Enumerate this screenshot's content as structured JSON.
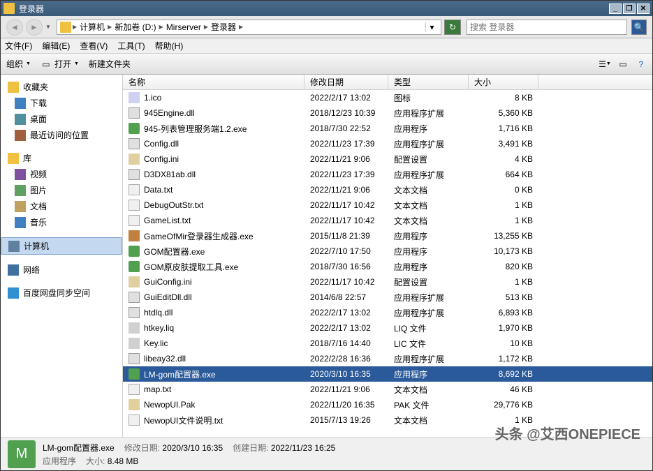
{
  "window": {
    "title": "登录器"
  },
  "address": {
    "segments": [
      "计算机",
      "新加卷 (D:)",
      "Mirserver",
      "登录器"
    ]
  },
  "search": {
    "placeholder": "搜索 登录器"
  },
  "menu": {
    "file": "文件(F)",
    "edit": "编辑(E)",
    "view": "查看(V)",
    "tools": "工具(T)",
    "help": "帮助(H)"
  },
  "toolbar": {
    "org": "组织",
    "open": "打开",
    "newfolder": "新建文件夹"
  },
  "sidebar": {
    "fav": "收藏夹",
    "dl": "下载",
    "desk": "桌面",
    "recent": "最近访问的位置",
    "lib": "库",
    "vid": "视频",
    "pic": "图片",
    "doc": "文档",
    "music": "音乐",
    "pc": "计算机",
    "net": "网络",
    "baidu": "百度网盘同步空间"
  },
  "columns": {
    "name": "名称",
    "modified": "修改日期",
    "type": "类型",
    "size": "大小"
  },
  "files": [
    {
      "name": "1.ico",
      "date": "2022/2/17 13:02",
      "type": "图标",
      "size": "8 KB",
      "ico": "fi-ico"
    },
    {
      "name": "945Engine.dll",
      "date": "2018/12/23 10:39",
      "type": "应用程序扩展",
      "size": "5,360 KB",
      "ico": "fi-dll"
    },
    {
      "name": "945-列表管理服务端1.2.exe",
      "date": "2018/7/30 22:52",
      "type": "应用程序",
      "size": "1,716 KB",
      "ico": "fi-exe"
    },
    {
      "name": "Config.dll",
      "date": "2022/11/23 17:39",
      "type": "应用程序扩展",
      "size": "3,491 KB",
      "ico": "fi-dll"
    },
    {
      "name": "Config.ini",
      "date": "2022/11/21 9:06",
      "type": "配置设置",
      "size": "4 KB",
      "ico": "fi-ini"
    },
    {
      "name": "D3DX81ab.dll",
      "date": "2022/11/23 17:39",
      "type": "应用程序扩展",
      "size": "664 KB",
      "ico": "fi-dll"
    },
    {
      "name": "Data.txt",
      "date": "2022/11/21 9:06",
      "type": "文本文档",
      "size": "0 KB",
      "ico": "fi-txt"
    },
    {
      "name": "DebugOutStr.txt",
      "date": "2022/11/17 10:42",
      "type": "文本文档",
      "size": "1 KB",
      "ico": "fi-txt"
    },
    {
      "name": "GameList.txt",
      "date": "2022/11/17 10:42",
      "type": "文本文档",
      "size": "1 KB",
      "ico": "fi-txt"
    },
    {
      "name": "GameOfMir登录器生成器.exe",
      "date": "2015/11/8 21:39",
      "type": "应用程序",
      "size": "13,255 KB",
      "ico": "fi-exe2"
    },
    {
      "name": "GOM配置器.exe",
      "date": "2022/7/10 17:50",
      "type": "应用程序",
      "size": "10,173 KB",
      "ico": "fi-exe"
    },
    {
      "name": "GOM原皮肤提取工具.exe",
      "date": "2018/7/30 16:56",
      "type": "应用程序",
      "size": "820 KB",
      "ico": "fi-exe"
    },
    {
      "name": "GuiConfig.ini",
      "date": "2022/11/17 10:42",
      "type": "配置设置",
      "size": "1 KB",
      "ico": "fi-ini"
    },
    {
      "name": "GuiEditDll.dll",
      "date": "2014/6/8 22:57",
      "type": "应用程序扩展",
      "size": "513 KB",
      "ico": "fi-dll"
    },
    {
      "name": "htdlq.dll",
      "date": "2022/2/17 13:02",
      "type": "应用程序扩展",
      "size": "6,893 KB",
      "ico": "fi-dll"
    },
    {
      "name": "htkey.liq",
      "date": "2022/2/17 13:02",
      "type": "LIQ 文件",
      "size": "1,970 KB",
      "ico": "fi-lic"
    },
    {
      "name": "Key.lic",
      "date": "2018/7/16 14:40",
      "type": "LIC 文件",
      "size": "10 KB",
      "ico": "fi-lic"
    },
    {
      "name": "libeay32.dll",
      "date": "2022/2/28 16:36",
      "type": "应用程序扩展",
      "size": "1,172 KB",
      "ico": "fi-dll"
    },
    {
      "name": "LM-gom配置器.exe",
      "date": "2020/3/10 16:35",
      "type": "应用程序",
      "size": "8,692 KB",
      "ico": "fi-exe",
      "selected": true
    },
    {
      "name": "map.txt",
      "date": "2022/11/21 9:06",
      "type": "文本文档",
      "size": "46 KB",
      "ico": "fi-txt"
    },
    {
      "name": "NewopUI.Pak",
      "date": "2022/11/20 16:35",
      "type": "PAK 文件",
      "size": "29,776 KB",
      "ico": "fi-pak"
    },
    {
      "name": "NewopUI文件说明.txt",
      "date": "2015/7/13 19:26",
      "type": "文本文档",
      "size": "1 KB",
      "ico": "fi-txt"
    }
  ],
  "status": {
    "filename": "LM-gom配置器.exe",
    "mod_label": "修改日期:",
    "mod_val": "2020/3/10 16:35",
    "create_label": "创建日期:",
    "create_val": "2022/11/23 16:25",
    "type": "应用程序",
    "size_label": "大小:",
    "size_val": "8.48 MB"
  },
  "watermark": "头条 @艾西ONEPIECE"
}
